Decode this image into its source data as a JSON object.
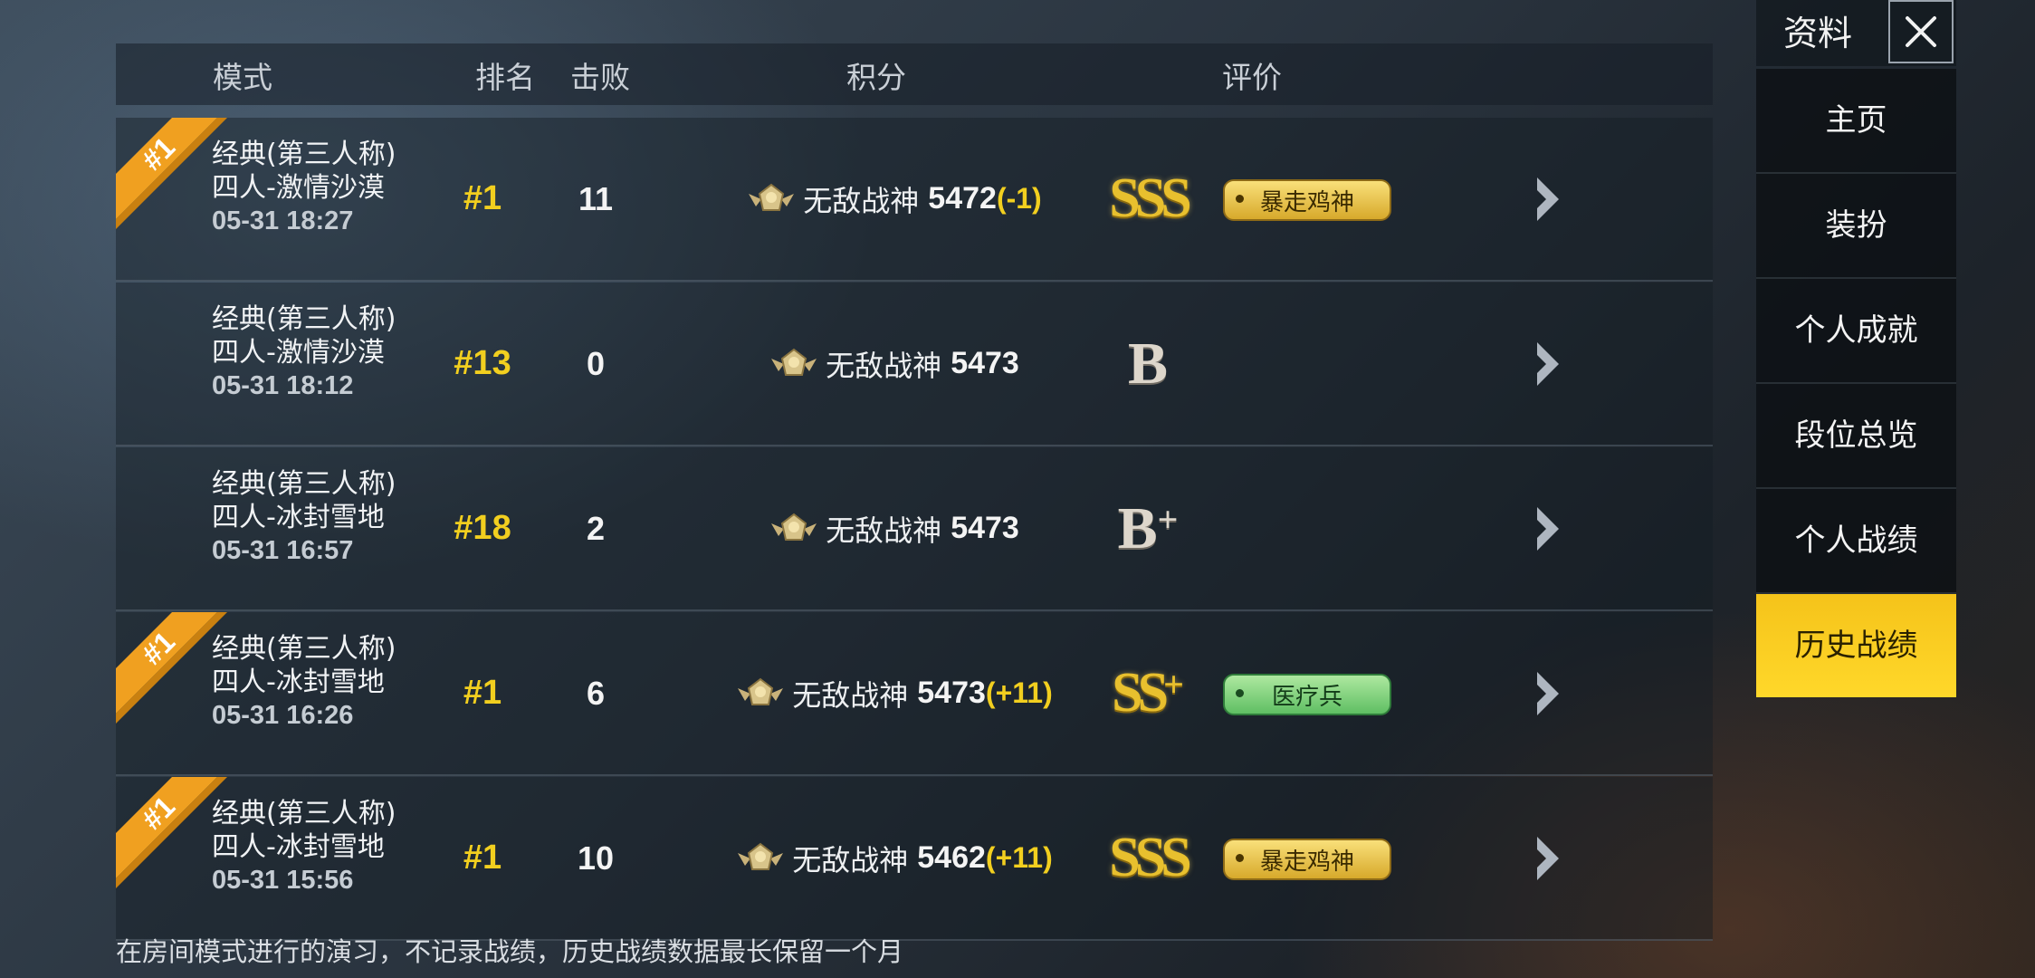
{
  "header": {
    "mode": "模式",
    "rank": "排名",
    "kills": "击败",
    "score": "积分",
    "rating": "评价"
  },
  "rows": [
    {
      "winner": true,
      "ribbon": "#1",
      "mode": "经典(第三人称)",
      "map": "四人-激情沙漠",
      "date": "05-31 18:27",
      "rank": "#1",
      "kills": "11",
      "tier": "无敌战神",
      "points": "5472",
      "delta": "(-1)",
      "grade": "SSS",
      "grade_plus": "",
      "grade_style": "gold",
      "tag": "暴走鸡神",
      "tag_style": "gold"
    },
    {
      "winner": false,
      "ribbon": "",
      "mode": "经典(第三人称)",
      "map": "四人-激情沙漠",
      "date": "05-31 18:12",
      "rank": "#13",
      "kills": "0",
      "tier": "无敌战神",
      "points": "5473",
      "delta": "",
      "grade": "B",
      "grade_plus": "",
      "grade_style": "silver",
      "tag": "",
      "tag_style": ""
    },
    {
      "winner": false,
      "ribbon": "",
      "mode": "经典(第三人称)",
      "map": "四人-冰封雪地",
      "date": "05-31 16:57",
      "rank": "#18",
      "kills": "2",
      "tier": "无敌战神",
      "points": "5473",
      "delta": "",
      "grade": "B",
      "grade_plus": "+",
      "grade_style": "silver",
      "tag": "",
      "tag_style": ""
    },
    {
      "winner": true,
      "ribbon": "#1",
      "mode": "经典(第三人称)",
      "map": "四人-冰封雪地",
      "date": "05-31 16:26",
      "rank": "#1",
      "kills": "6",
      "tier": "无敌战神",
      "points": "5473",
      "delta": "(+11)",
      "grade": "SS",
      "grade_plus": "+",
      "grade_style": "gold",
      "tag": "医疗兵",
      "tag_style": "green"
    },
    {
      "winner": true,
      "ribbon": "#1",
      "mode": "经典(第三人称)",
      "map": "四人-冰封雪地",
      "date": "05-31 15:56",
      "rank": "#1",
      "kills": "10",
      "tier": "无敌战神",
      "points": "5462",
      "delta": "(+11)",
      "grade": "SSS",
      "grade_plus": "",
      "grade_style": "gold",
      "tag": "暴走鸡神",
      "tag_style": "gold"
    }
  ],
  "footer": "在房间模式进行的演习，不记录战绩，历史战绩数据最长保留一个月",
  "sidebar": {
    "title": "资料",
    "items": [
      {
        "label": "主页",
        "active": false
      },
      {
        "label": "装扮",
        "active": false
      },
      {
        "label": "个人成就",
        "active": false
      },
      {
        "label": "段位总览",
        "active": false
      },
      {
        "label": "个人战绩",
        "active": false
      },
      {
        "label": "历史战绩",
        "active": true
      }
    ]
  },
  "colors": {
    "accent_yellow": "#f2cf1f",
    "active_tab": "#ffd82a",
    "ribbon_orange": "#f0a020"
  }
}
